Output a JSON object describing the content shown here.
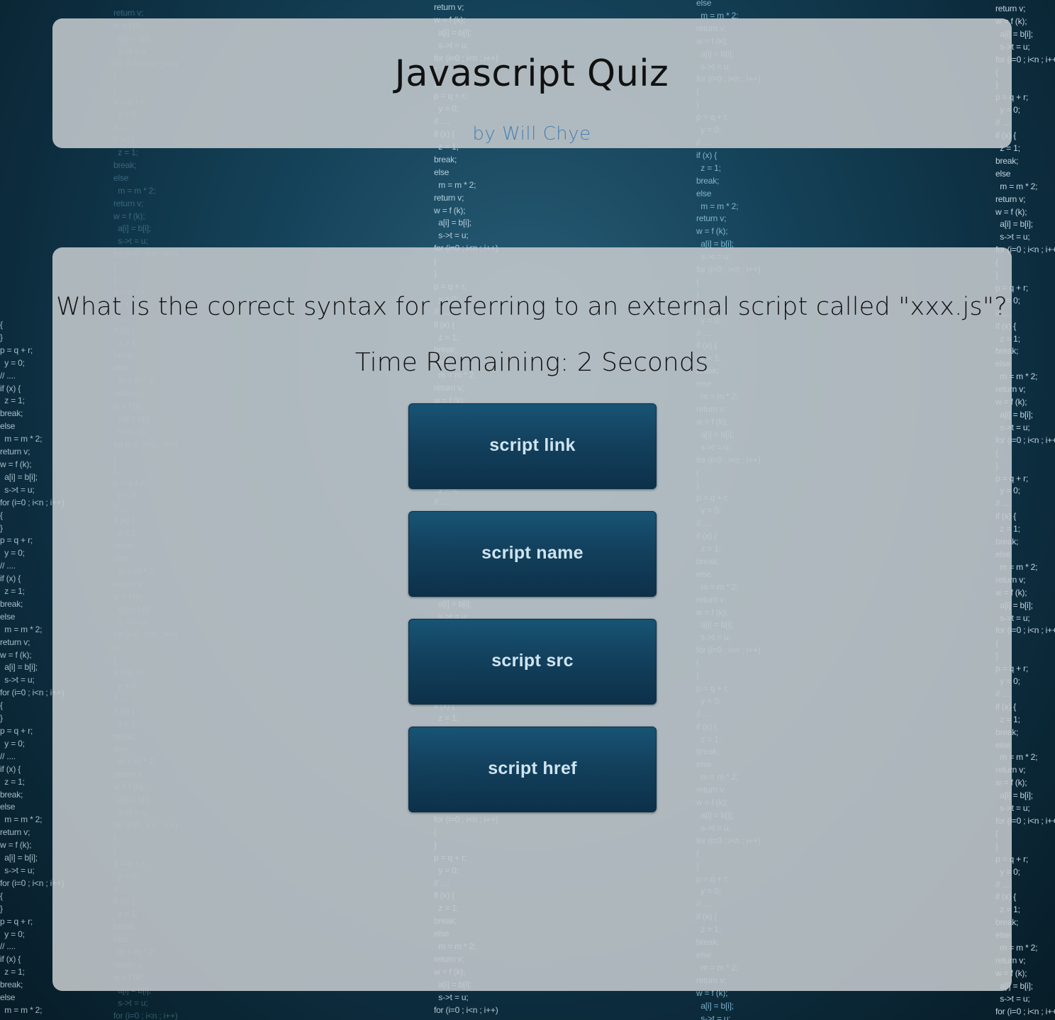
{
  "header": {
    "title": "Javascript Quiz",
    "byline": "by Will Chye"
  },
  "quiz": {
    "question": "What is the correct syntax for referring to an external script called \"xxx.js\"?",
    "timer_text": "Time Remaining: 2 Seconds",
    "answers": [
      {
        "label": "script link"
      },
      {
        "label": "script name"
      },
      {
        "label": "script src"
      },
      {
        "label": "script href"
      }
    ]
  },
  "colors": {
    "panel": "#c4cacd",
    "button": "#0a3a58",
    "button_text": "#cfe4f0",
    "byline": "#4a7fb0",
    "background": "#15435a"
  }
}
